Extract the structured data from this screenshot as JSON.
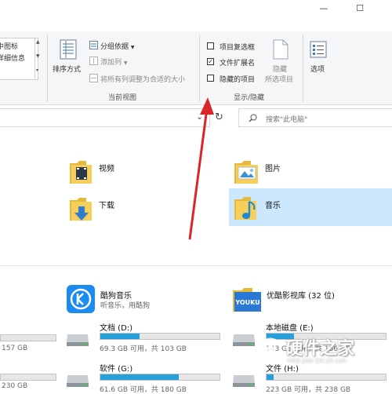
{
  "window": {
    "minimize": "—",
    "maximize": "☐"
  },
  "ribbon": {
    "layout": {
      "medium_icons": "中图标",
      "details": "详细信息",
      "scroll_up": "▲",
      "scroll_down": "▼",
      "scroll_more": "▾"
    },
    "current_view": {
      "sort_by": "排序方式",
      "group_by": "分组依据",
      "add_column": "添加列",
      "fit_columns": "将所有列调整为合适的大小",
      "group_label": "当前视图"
    },
    "show_hide": {
      "item_checkboxes": {
        "label": "项目复选框",
        "checked": false
      },
      "file_extensions": {
        "label": "文件扩展名",
        "checked": true
      },
      "hidden_items": {
        "label": "隐藏的项目",
        "checked": false
      },
      "hide_selected": "隐藏\n所选项目",
      "hide_line1": "隐藏",
      "hide_line2": "所选项目",
      "group_label": "显示/隐藏",
      "options": "选项"
    }
  },
  "address": {
    "dropdown": "⌄",
    "refresh": "↻",
    "search_placeholder": "搜索\"此电脑\""
  },
  "folders": [
    {
      "name": "视频"
    },
    {
      "name": "图片"
    },
    {
      "name": "下载"
    },
    {
      "name": "音乐"
    }
  ],
  "apps": [
    {
      "name": "酷狗音乐",
      "desc": "听音乐，用酷狗"
    },
    {
      "name": "优酷影视库 (32 位)"
    }
  ],
  "drives": [
    {
      "name": "",
      "info": "157 GB",
      "fill": 0.0
    },
    {
      "name": "文档 (D:)",
      "info": "69.3 GB 可用，共 103 GB",
      "fill": 0.33
    },
    {
      "name": "本地磁盘 (E:)",
      "info": "143 GB 可用，共 186 GB",
      "fill": 0.23
    },
    {
      "name": "",
      "info": "230 GB",
      "fill": 0.0
    },
    {
      "name": "软件 (G:)",
      "info": "61.6 GB 可用，共 180 GB",
      "fill": 0.66
    },
    {
      "name": "文件 (H:)",
      "info": "223 GB 可用，共 238 GB",
      "fill": 0.06
    }
  ],
  "watermark": {
    "title": "硬件之家",
    "url": "YING JIAN ZHI JIA.com"
  },
  "colors": {
    "accent": "#26a0da",
    "selected_bg": "#cce8ff",
    "arrow": "#d8262b",
    "folder": "#f2c94c"
  }
}
